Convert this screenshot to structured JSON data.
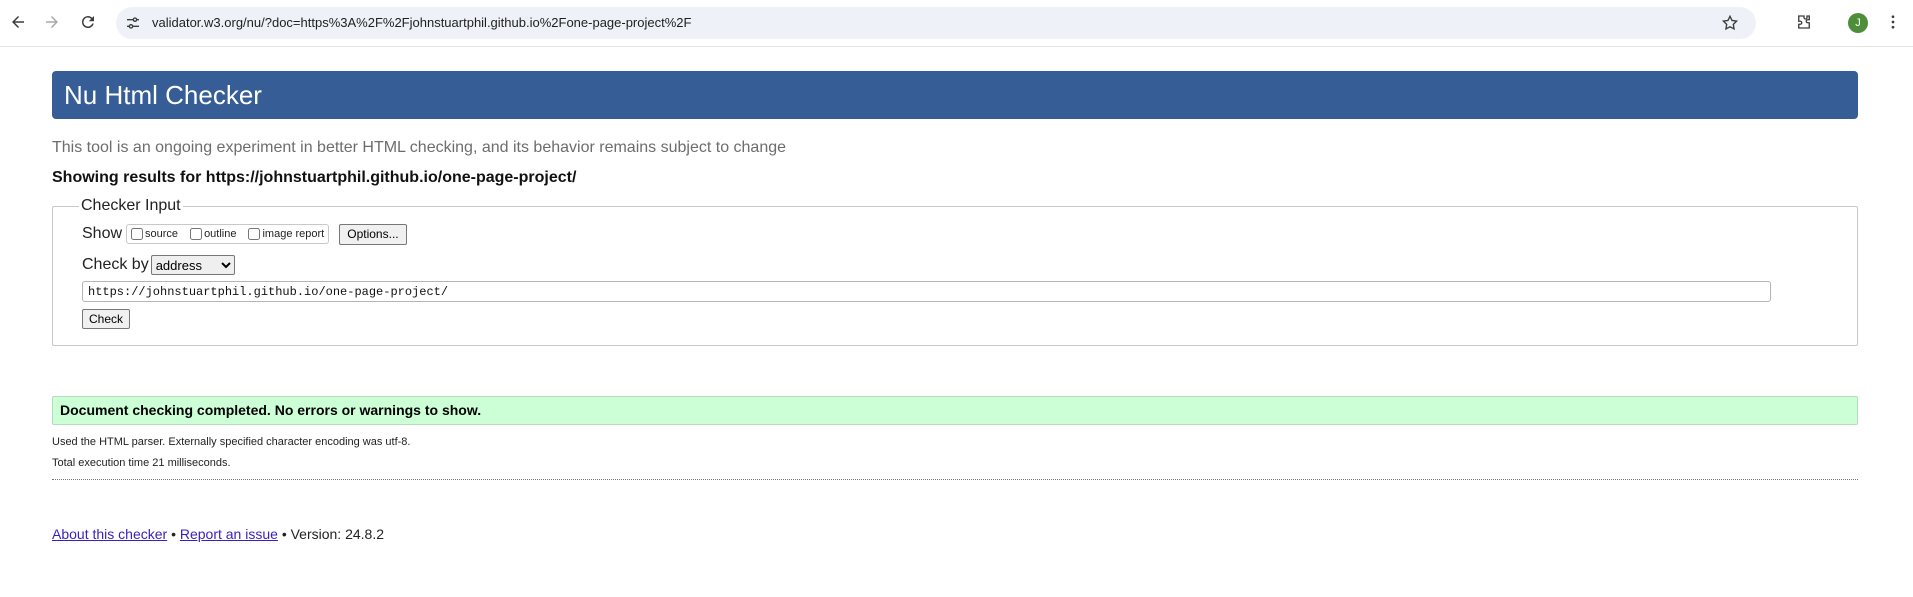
{
  "browser": {
    "url": "validator.w3.org/nu/?doc=https%3A%2F%2Fjohnstuartphil.github.io%2Fone-page-project%2F",
    "avatar_letter": "J"
  },
  "page": {
    "title": "Nu Html Checker",
    "subtitle": "This tool is an ongoing experiment in better HTML checking, and its behavior remains subject to change",
    "showing_results": "Showing results for https://johnstuartphil.github.io/one-page-project/",
    "checker": {
      "legend": "Checker Input",
      "show_label": "Show",
      "options": [
        {
          "label": "source",
          "checked": false
        },
        {
          "label": "outline",
          "checked": false
        },
        {
          "label": "image report",
          "checked": false
        }
      ],
      "options_button": "Options...",
      "check_by_label": "Check by",
      "check_by_value": "address",
      "url_value": "https://johnstuartphil.github.io/one-page-project/",
      "check_button": "Check"
    },
    "result_message": "Document checking completed. No errors or warnings to show.",
    "details": [
      "Used the HTML parser. Externally specified character encoding was utf-8.",
      "Total execution time 21 milliseconds."
    ],
    "footer": {
      "about_link": "About this checker",
      "separator": "•",
      "report_link": "Report an issue",
      "version": "Version: 24.8.2"
    }
  },
  "colors": {
    "header_bg": "#365d95",
    "success_bg": "#ccffd6",
    "link": "#3a1fbf"
  }
}
